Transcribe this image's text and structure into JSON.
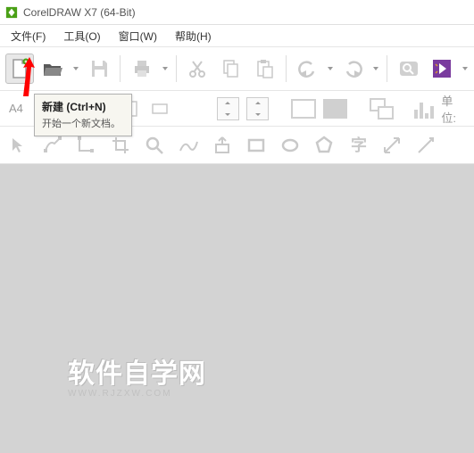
{
  "titlebar": {
    "title": "CorelDRAW X7 (64-Bit)"
  },
  "menubar": {
    "file": "文件(F)",
    "tools": "工具(O)",
    "window": "窗口(W)",
    "help": "帮助(H)"
  },
  "toolbar": {
    "new": "新建",
    "open": "打开",
    "save": "保存",
    "print": "打印",
    "cut": "剪切",
    "copy": "复制",
    "paste": "粘贴",
    "undo": "撤销",
    "redo": "重做",
    "search": "搜索",
    "launcher": "启动器"
  },
  "tooltip": {
    "title": "新建 (Ctrl+N)",
    "desc": "开始一个新文档。"
  },
  "propbar": {
    "paper": "A4",
    "unit_label": "单位:"
  },
  "watermark": {
    "line1": "软件自学网",
    "line2": "WWW.RJZXW.COM"
  },
  "colors": {
    "icon_gray": "#c9c9c9",
    "accent_green": "#4aa016",
    "launcher_purple": "#7a3b9e"
  }
}
